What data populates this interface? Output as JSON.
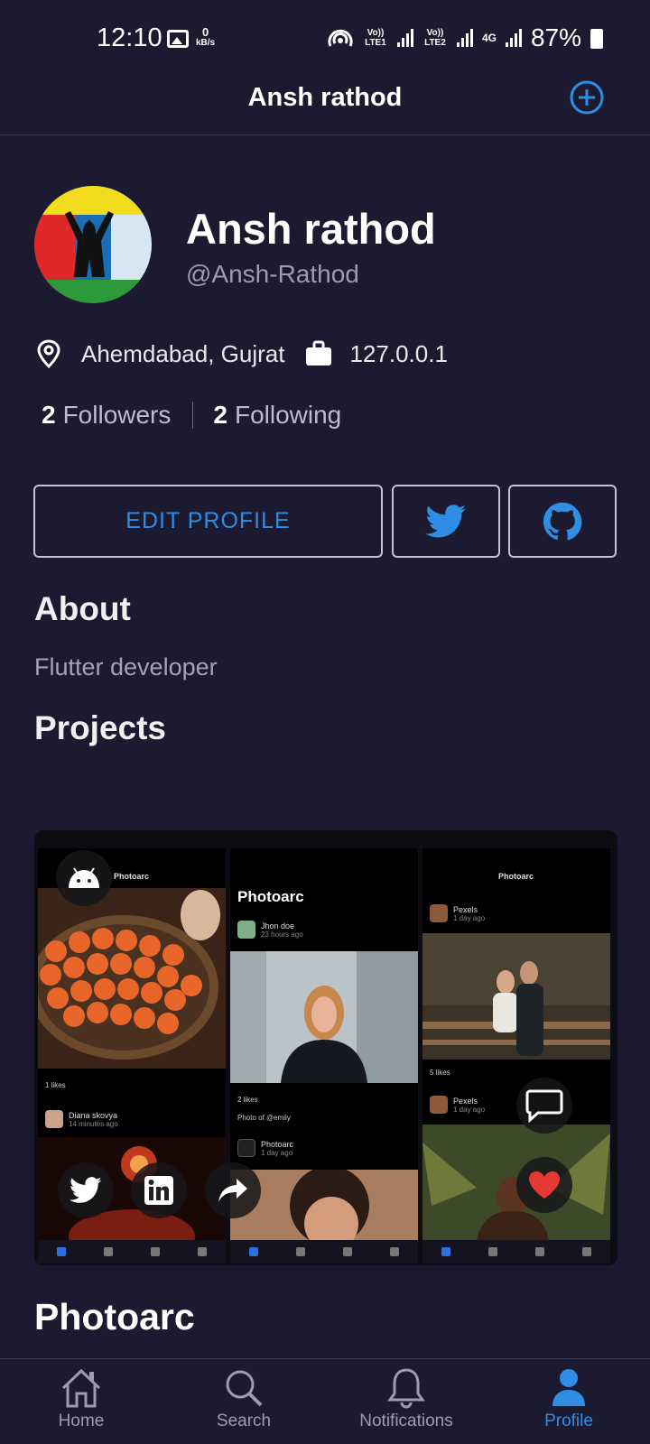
{
  "status_bar": {
    "time": "12:10",
    "net_speed_value": "0",
    "net_speed_unit": "kB/s",
    "sim1": "Vo)) LTE1",
    "sim2": "Vo)) LTE2",
    "network_type": "4G",
    "battery": "87%"
  },
  "app_bar": {
    "title": "Ansh rathod",
    "add_icon": "plus-circle-icon"
  },
  "profile": {
    "name": "Ansh rathod",
    "handle": "@Ansh-Rathod",
    "location": "Ahemdabad, Gujrat",
    "company": "127.0.0.1",
    "followers_count": "2",
    "followers_label": "Followers",
    "following_count": "2",
    "following_label": "Following"
  },
  "actions": {
    "edit_profile_label": "EDIT PROFILE",
    "twitter_icon": "twitter-icon",
    "github_icon": "github-icon"
  },
  "about": {
    "heading": "About",
    "text": "Flutter developer"
  },
  "projects": {
    "heading": "Projects",
    "card": {
      "title": "Photoarc",
      "shot1": {
        "app_name": "Photoarc",
        "likes": "1 likes",
        "post_user": "Diana skovya",
        "post_time": "14 minutes ago"
      },
      "shot2": {
        "app_title": "Photoarc",
        "post_user": "Jhon doe",
        "post_time": "23 hours ago",
        "likes": "2 likes",
        "caption": "Photo of @emily",
        "post2_user": "Photoarc",
        "post2_time": "1 day ago"
      },
      "shot3": {
        "app_name": "Photoarc",
        "post_user": "Pexels",
        "post_time": "1 day ago",
        "likes": "5 likes",
        "post2_user": "Pexels",
        "post2_time": "1 day ago"
      }
    }
  },
  "bottom_nav": {
    "items": [
      {
        "label": "Home",
        "icon": "home-icon"
      },
      {
        "label": "Search",
        "icon": "search-icon"
      },
      {
        "label": "Notifications",
        "icon": "bell-icon"
      },
      {
        "label": "Profile",
        "icon": "person-icon"
      }
    ],
    "active": "Profile"
  },
  "colors": {
    "background": "#1c1a30",
    "accent": "#2f8de4",
    "heart": "#e53935"
  }
}
